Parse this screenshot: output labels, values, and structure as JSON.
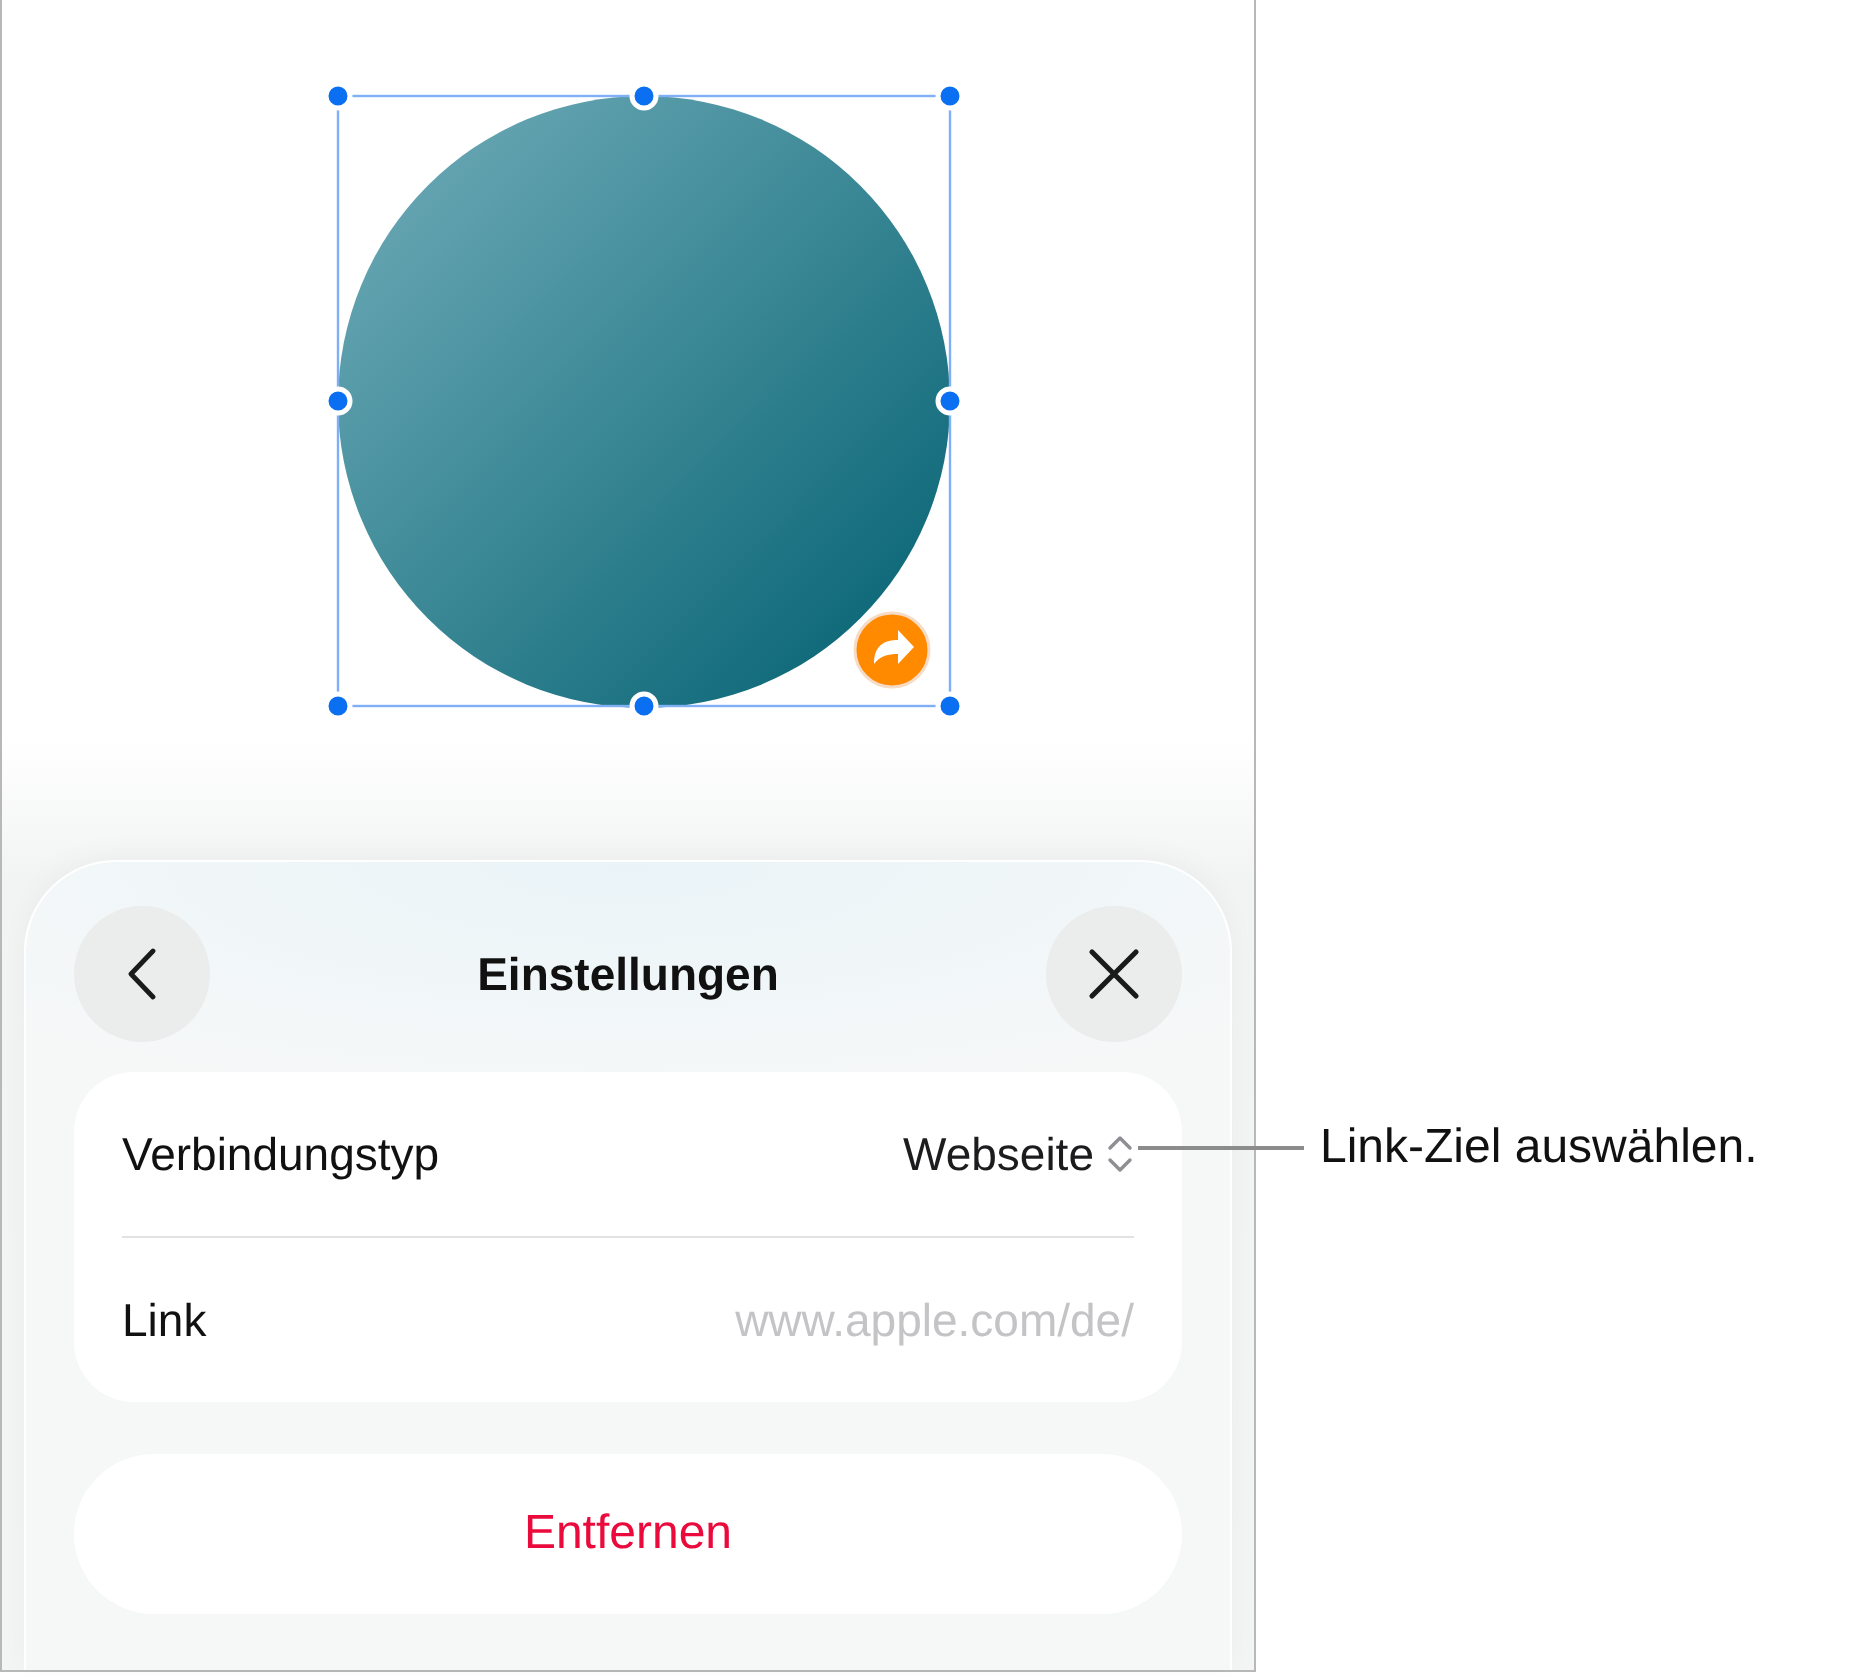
{
  "canvas": {
    "shape": {
      "selected": true,
      "linked": true
    }
  },
  "sheet": {
    "title": "Einstellungen",
    "rows": [
      {
        "kind": "picker",
        "label": "Verbindungstyp",
        "value": "Webseite"
      },
      {
        "kind": "field",
        "label": "Link",
        "placeholder": "www.apple.com/de/"
      }
    ],
    "remove_button": {
      "label": "Entfernen"
    }
  },
  "callout": {
    "text": "Link-Ziel auswählen."
  }
}
